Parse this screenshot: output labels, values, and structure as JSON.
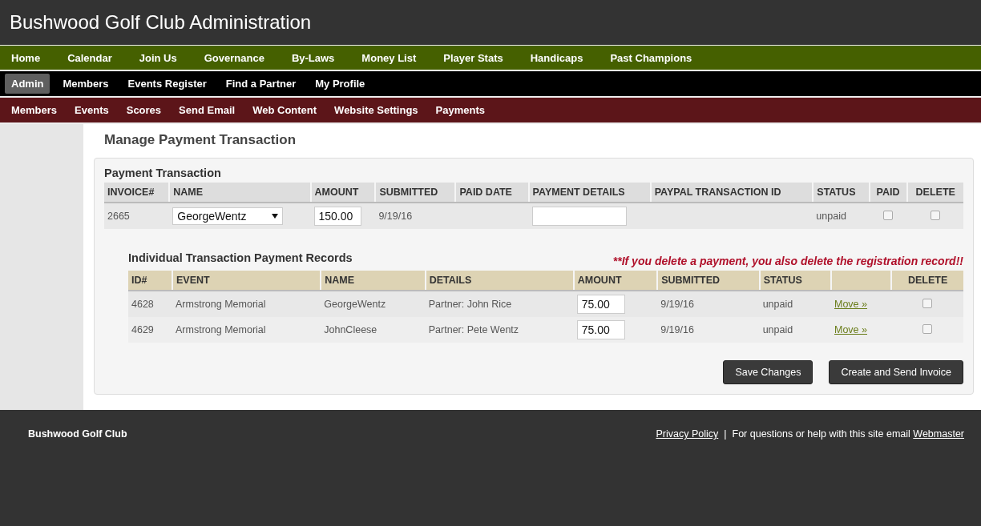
{
  "site_title": "Bushwood Golf Club Administration",
  "main_nav": [
    {
      "label": "Home",
      "selected": false
    },
    {
      "label": "Calendar",
      "selected": false
    },
    {
      "label": "Join Us",
      "selected": false
    },
    {
      "label": "Governance",
      "selected": false
    },
    {
      "label": "By-Laws",
      "selected": false
    },
    {
      "label": "Money List",
      "selected": false
    },
    {
      "label": "Player Stats",
      "selected": false
    },
    {
      "label": "Handicaps",
      "selected": false
    },
    {
      "label": "Past Champions",
      "selected": false
    }
  ],
  "member_nav": [
    {
      "label": "Admin",
      "selected": true
    },
    {
      "label": "Members",
      "selected": false
    },
    {
      "label": "Events Register",
      "selected": false
    },
    {
      "label": "Find a Partner",
      "selected": false
    },
    {
      "label": "My Profile",
      "selected": false
    }
  ],
  "admin_nav": [
    {
      "label": "Members",
      "selected": false
    },
    {
      "label": "Events",
      "selected": false
    },
    {
      "label": "Scores",
      "selected": false
    },
    {
      "label": "Send Email",
      "selected": false
    },
    {
      "label": "Web Content",
      "selected": false
    },
    {
      "label": "Website Settings",
      "selected": false
    },
    {
      "label": "Payments",
      "selected": false
    }
  ],
  "page_title": "Manage Payment Transaction",
  "transaction": {
    "title": "Payment Transaction",
    "columns": [
      "INVOICE#",
      "NAME",
      "AMOUNT",
      "SUBMITTED",
      "PAID DATE",
      "PAYMENT DETAILS",
      "PAYPAL TRANSACTION ID",
      "STATUS",
      "PAID",
      "DELETE"
    ],
    "row": {
      "invoice": "2665",
      "name": "GeorgeWentz",
      "amount": "150.00",
      "submitted": "9/19/16",
      "status": "unpaid",
      "paid": false,
      "delete": false
    }
  },
  "records": {
    "title": "Individual Transaction Payment Records",
    "warning": "**If you delete a payment, you also delete the registration record!!",
    "columns": [
      "ID#",
      "EVENT",
      "NAME",
      "DETAILS",
      "AMOUNT",
      "SUBMITTED",
      "STATUS",
      "DELETE"
    ],
    "rows": [
      {
        "id": "4628",
        "event": "Armstrong Memorial",
        "name": "GeorgeWentz",
        "details": "Partner: John Rice",
        "amount": "75.00",
        "submitted": "9/19/16",
        "status": "unpaid",
        "link": "Move »",
        "delete": false
      },
      {
        "id": "4629",
        "event": "Armstrong Memorial",
        "name": "JohnCleese",
        "details": "Partner: Pete Wentz",
        "amount": "75.00",
        "submitted": "9/19/16",
        "status": "unpaid",
        "link": "Move »",
        "delete": false
      }
    ]
  },
  "buttons": [
    "Save Changes",
    "Create and Send Invoice"
  ],
  "footer": {
    "club": "Bushwood Golf Club",
    "privacy_link": "Privacy Policy",
    "separator": "|",
    "note": "For questions or help with this site email",
    "webmaster_link": "Webmaster"
  }
}
